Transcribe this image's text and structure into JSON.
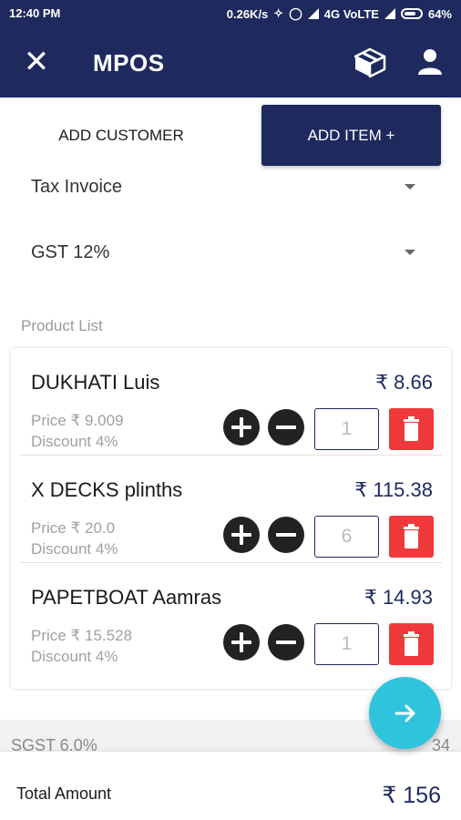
{
  "status_bar": {
    "time": "12:40 PM",
    "speed": "0.26K/s",
    "network": "4G VoLTE",
    "battery": "64%"
  },
  "app_bar": {
    "title": "MPOS"
  },
  "tabs": {
    "add_customer": "ADD CUSTOMER",
    "add_item": "ADD ITEM +"
  },
  "invoice_type": {
    "value": "Tax Invoice"
  },
  "gst_rate": {
    "value": "GST 12%"
  },
  "product_list": {
    "label": "Product List",
    "items": [
      {
        "name": "DUKHATI Luis",
        "total": "₹ 8.66",
        "price": "Price ₹ 9.009",
        "discount": "Discount 4%",
        "qty": "1"
      },
      {
        "name": "X DECKS plinths",
        "total": "₹ 115.38",
        "price": "Price ₹ 20.0",
        "discount": "Discount 4%",
        "qty": "6"
      },
      {
        "name": "PAPETBOAT Aamras",
        "total": "₹ 14.93",
        "price": "Price ₹ 15.528",
        "discount": "Discount 4%",
        "qty": "1"
      }
    ]
  },
  "tax_row": {
    "label": "SGST 6.0%",
    "value": "34"
  },
  "total": {
    "label": "Total Amount",
    "value": "₹ 156"
  },
  "colors": {
    "primary": "#1e2a5e",
    "delete": "#f0393b",
    "fab": "#2ec4dc"
  },
  "icons": {
    "close": "close-icon",
    "box": "box-icon",
    "user": "user-icon",
    "plus": "plus-icon",
    "minus": "minus-icon",
    "trash": "trash-icon",
    "arrow": "arrow-right-icon"
  }
}
